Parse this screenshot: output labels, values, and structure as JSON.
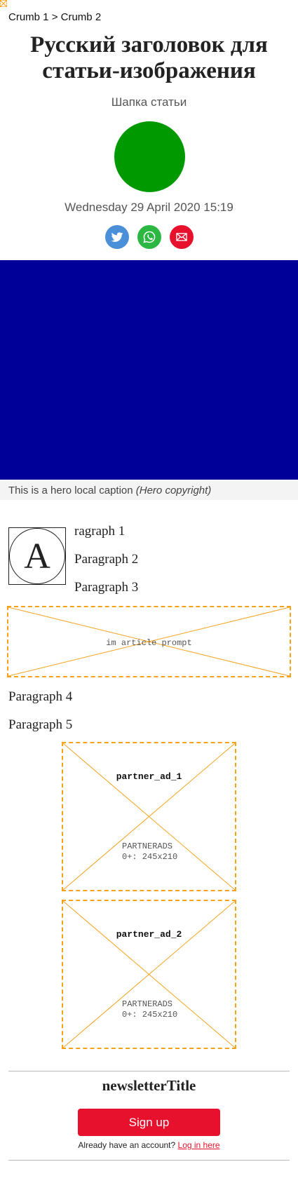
{
  "breadcrumb": {
    "crumb1": "Crumb 1",
    "separator": ">",
    "crumb2": "Crumb 2"
  },
  "article": {
    "title": "Русский заголовок для статьи-изображения",
    "standfirst": "Шапка статьи",
    "date": "Wednesday 29 April 2020 15:19",
    "hero_caption": "This is a hero local caption",
    "hero_copyright": "(Hero copyright)",
    "dropcap_letter": "A",
    "paragraphs": [
      "ragraph 1",
      "Paragraph 2",
      "Paragraph 3",
      "Paragraph 4",
      "Paragraph 5"
    ]
  },
  "share": {
    "icons": [
      "twitter-icon",
      "whatsapp-icon",
      "email-icon"
    ],
    "colors": {
      "twitter": "#4a90d9",
      "whatsapp": "#2bb741",
      "email": "#e8112d"
    }
  },
  "colors": {
    "avatar": "#009900",
    "hero": "#000099",
    "placeholder_border": "#f7a21b",
    "accent": "#e8112d"
  },
  "placeholders": {
    "article_prompt": "im article prompt",
    "ads": [
      {
        "name": "partner_ad_1",
        "type": "PARTNERADS",
        "size": "0+: 245x210"
      },
      {
        "name": "partner_ad_2",
        "type": "PARTNERADS",
        "size": "0+: 245x210"
      }
    ]
  },
  "newsletter": {
    "title": "newsletterTitle",
    "signup_label": "Sign up",
    "account_text": "Already have an account?",
    "login_link": "Log in here"
  }
}
